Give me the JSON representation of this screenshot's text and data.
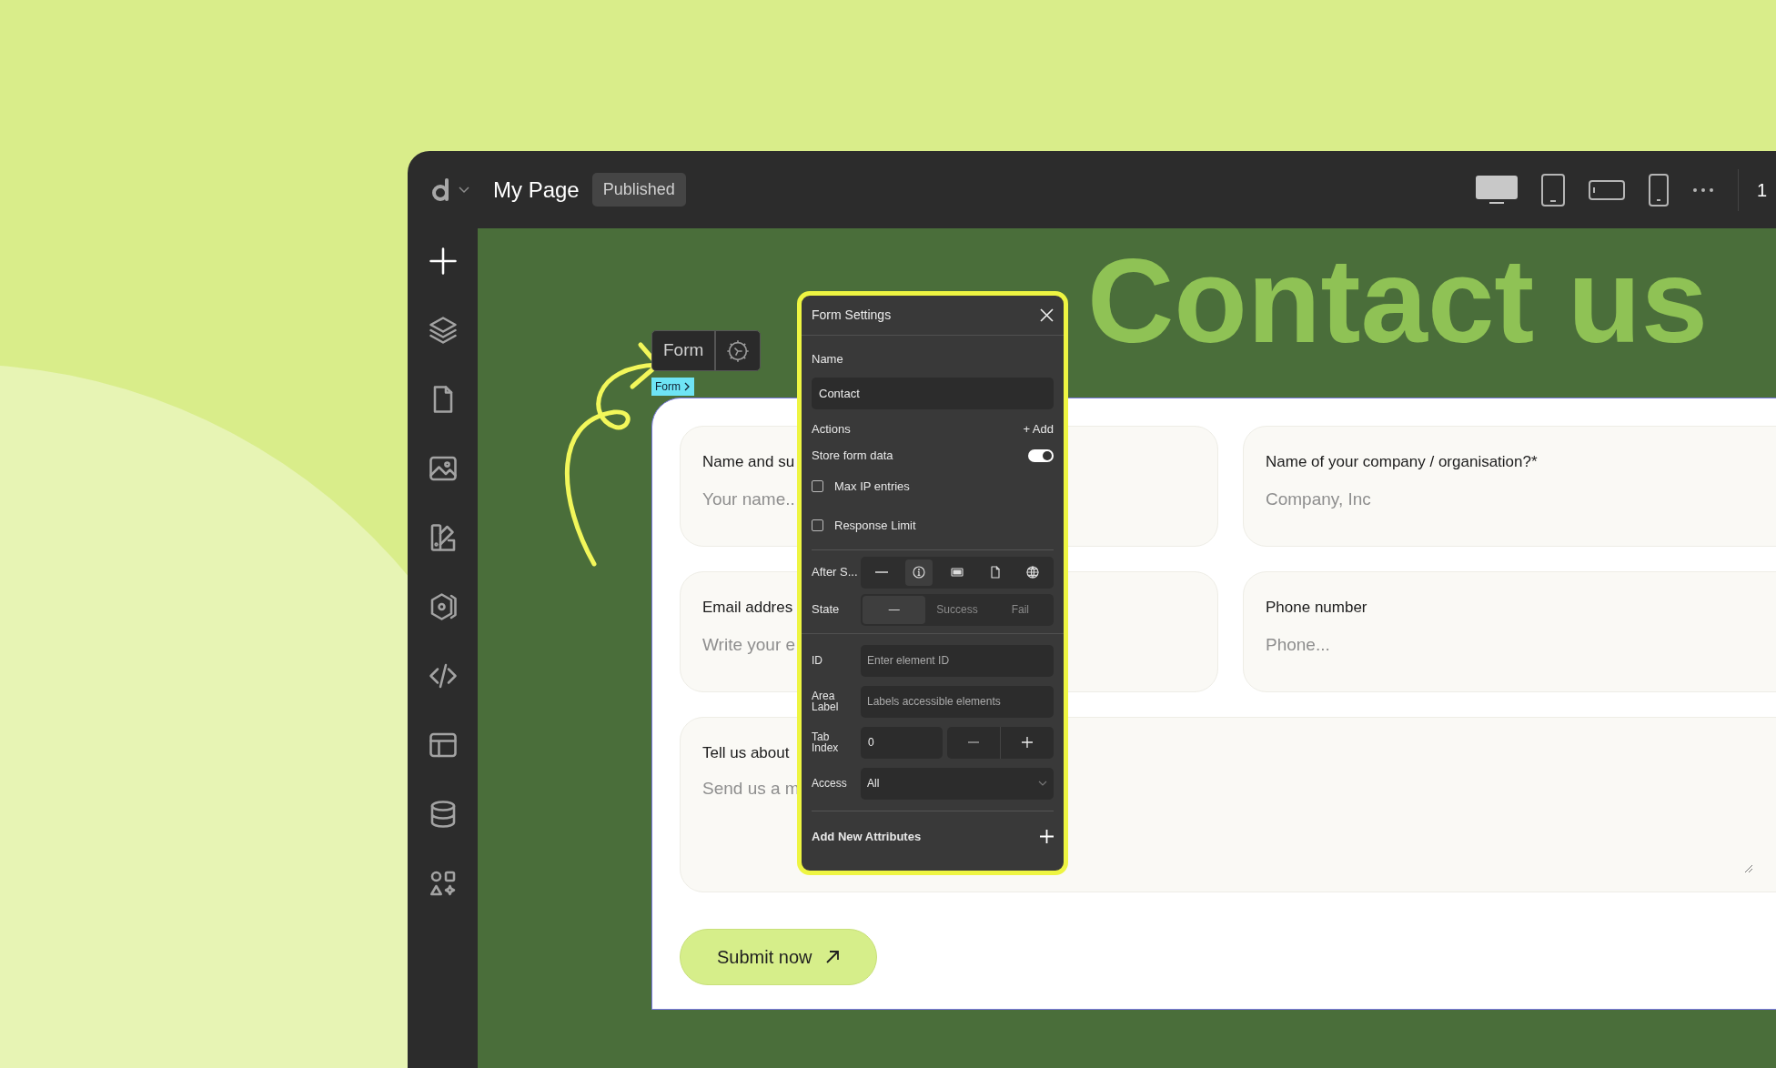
{
  "header": {
    "title": "My Page",
    "status": "Published",
    "devices": [
      {
        "kind": "desktop",
        "selected": true
      },
      {
        "kind": "tablet",
        "selected": false
      },
      {
        "kind": "landscape",
        "selected": false
      },
      {
        "kind": "phone",
        "selected": false
      }
    ],
    "zoom": "1"
  },
  "sidebar": {
    "items": [
      {
        "kind": "add"
      },
      {
        "kind": "layers"
      },
      {
        "kind": "page"
      },
      {
        "kind": "image"
      },
      {
        "kind": "swatch"
      },
      {
        "kind": "component"
      },
      {
        "kind": "code"
      },
      {
        "kind": "layout"
      },
      {
        "kind": "database"
      },
      {
        "kind": "apps"
      }
    ]
  },
  "canvas": {
    "heading": "Contact us",
    "element_label": "Form",
    "breadcrumb": "Form",
    "form": {
      "fields": [
        {
          "kind": "input",
          "label": "Name and su",
          "placeholder": "Your name.."
        },
        {
          "kind": "input",
          "label": "Name of your company / organisation?*",
          "placeholder": "Company, Inc"
        },
        {
          "kind": "input",
          "label": "Email addres",
          "placeholder": "Write your e"
        },
        {
          "kind": "input",
          "label": "Phone number",
          "placeholder": "Phone..."
        },
        {
          "kind": "textarea",
          "label": "Tell us about",
          "placeholder": "Send us a m"
        }
      ],
      "submit": "Submit now"
    }
  },
  "panel": {
    "title": "Form Settings",
    "name_label": "Name",
    "name_value": "Contact",
    "actions_label": "Actions",
    "add_action": "+ Add",
    "store": {
      "label": "Store form data",
      "on": true
    },
    "checkboxes": [
      {
        "label": "Max IP entries",
        "checked": false
      },
      {
        "label": "Response Limit",
        "checked": false
      }
    ],
    "after_submit": {
      "label": "After S...",
      "options": [
        {
          "kind": "none",
          "selected": false
        },
        {
          "kind": "info",
          "selected": true
        },
        {
          "kind": "modal",
          "selected": false
        },
        {
          "kind": "page",
          "selected": false
        },
        {
          "kind": "url",
          "selected": false
        }
      ]
    },
    "state": {
      "label": "State",
      "options": [
        {
          "label": "—",
          "selected": true
        },
        {
          "label": "Success",
          "selected": false
        },
        {
          "label": "Fail",
          "selected": false
        }
      ]
    },
    "id": {
      "label": "ID",
      "placeholder": "Enter element ID"
    },
    "area_label": {
      "label": "Area Label",
      "placeholder": "Labels accessible elements"
    },
    "tab_index": {
      "label": "Tab Index",
      "value": "0"
    },
    "access": {
      "label": "Access",
      "value": "All"
    },
    "add_attributes": "Add New Attributes"
  }
}
